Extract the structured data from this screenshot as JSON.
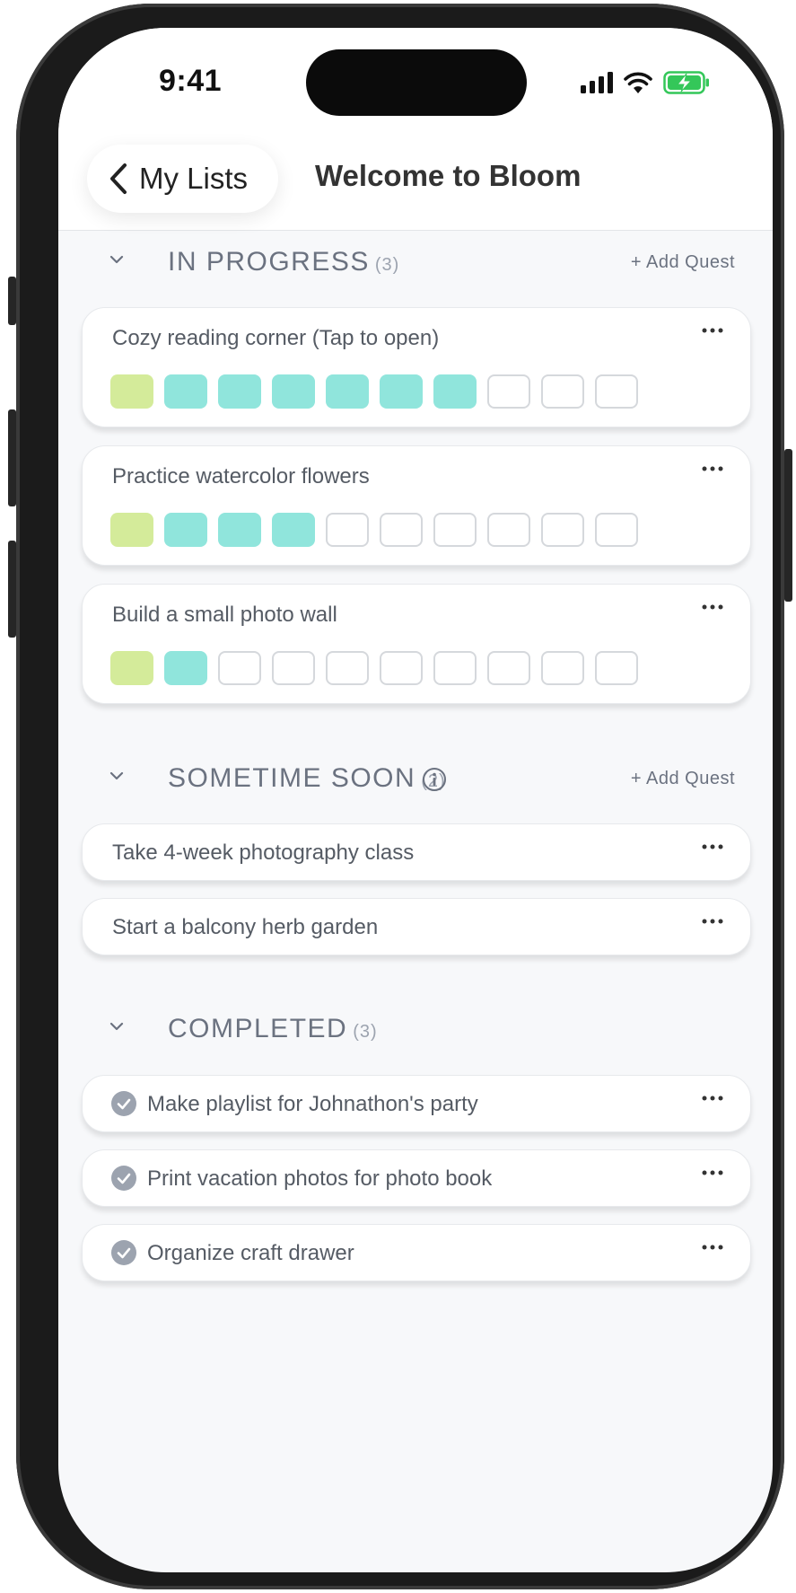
{
  "status_bar": {
    "time": "9:41"
  },
  "nav": {
    "back_label": "My Lists",
    "title": "Welcome to Bloom"
  },
  "sections": {
    "in_progress": {
      "title": "IN PROGRESS",
      "count": "(3)",
      "add_label": "+ Add Quest",
      "quests": [
        {
          "title": "Cozy reading corner (Tap to open)",
          "progress": [
            "lime",
            "teal",
            "teal",
            "teal",
            "teal",
            "teal",
            "teal",
            "empty",
            "empty",
            "empty"
          ]
        },
        {
          "title": "Practice watercolor flowers",
          "progress": [
            "lime",
            "teal",
            "teal",
            "teal",
            "empty",
            "empty",
            "empty",
            "empty",
            "empty",
            "empty"
          ]
        },
        {
          "title": "Build a small photo wall",
          "progress": [
            "lime",
            "teal",
            "empty",
            "empty",
            "empty",
            "empty",
            "empty",
            "empty",
            "empty",
            "empty"
          ]
        }
      ]
    },
    "sometime_soon": {
      "title": "SOMETIME SOON",
      "count": "(2)",
      "add_label": "+ Add Quest",
      "quests": [
        {
          "title": "Take 4-week photography class"
        },
        {
          "title": "Start a balcony herb garden"
        }
      ]
    },
    "completed": {
      "title": "COMPLETED",
      "count": "(3)",
      "quests": [
        {
          "title": "Make playlist for Johnathon's party"
        },
        {
          "title": "Print vacation photos for photo book"
        },
        {
          "title": "Organize craft drawer"
        }
      ]
    }
  },
  "colors": {
    "progress_lime": "#d4eb9a",
    "progress_teal": "#90e5dc",
    "battery_green": "#34c759"
  }
}
